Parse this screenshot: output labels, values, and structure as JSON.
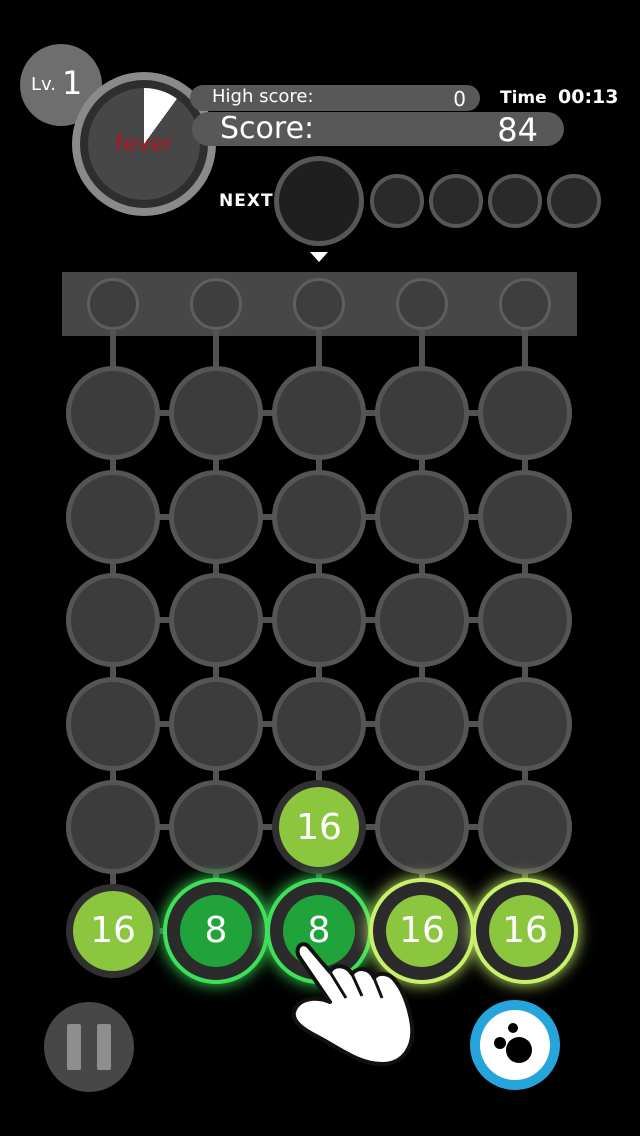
{
  "header": {
    "level_prefix": "Lv.",
    "level_value": "1",
    "fever_label": "fever",
    "fever_progress": 0.1,
    "high_score_label": "High score:",
    "high_score_value": "0",
    "time_label": "Time",
    "time_value": "00:13",
    "score_label": "Score:",
    "score_value": "84"
  },
  "next": {
    "label": "NEXT"
  },
  "board": {
    "columns": 5,
    "rows": 6,
    "tiles": [
      {
        "row": 4,
        "col": 2,
        "value": "16",
        "color": "#8cc63f",
        "glow": false
      },
      {
        "row": 5,
        "col": 0,
        "value": "16",
        "color": "#8cc63f",
        "glow": false
      },
      {
        "row": 5,
        "col": 1,
        "value": "8",
        "color": "#1fa33a",
        "glow": true
      },
      {
        "row": 5,
        "col": 2,
        "value": "8",
        "color": "#1fa33a",
        "glow": true
      },
      {
        "row": 5,
        "col": 3,
        "value": "16",
        "color": "#8cc63f",
        "glow": true
      },
      {
        "row": 5,
        "col": 4,
        "value": "16",
        "color": "#8cc63f",
        "glow": true
      }
    ]
  },
  "controls": {
    "pause_icon": "pause-icon",
    "bomb_icon": "bomb-icon"
  },
  "colors": {
    "accent_green": "#8cc63f",
    "dark_green": "#1fa33a",
    "fever_red": "#b0161c",
    "bomb_blue": "#26a4dc"
  }
}
